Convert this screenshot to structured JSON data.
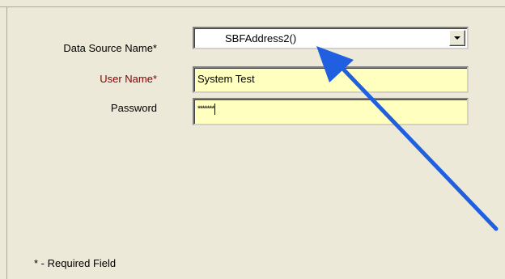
{
  "form": {
    "dsn_label": "Data Source Name*",
    "user_label": "User Name*",
    "password_label": "Password",
    "dsn_value": "SBFAddress2()",
    "user_value": "System Test",
    "password_masked": "*******",
    "footnote": "* - Required Field"
  },
  "colors": {
    "background": "#ece9d8",
    "field_background": "#ffffc0",
    "user_label_color": "#800000",
    "annotation_arrow": "#1f5fe0"
  },
  "icons": {
    "dropdown": "chevron-down-icon",
    "annotation": "arrow-icon"
  }
}
